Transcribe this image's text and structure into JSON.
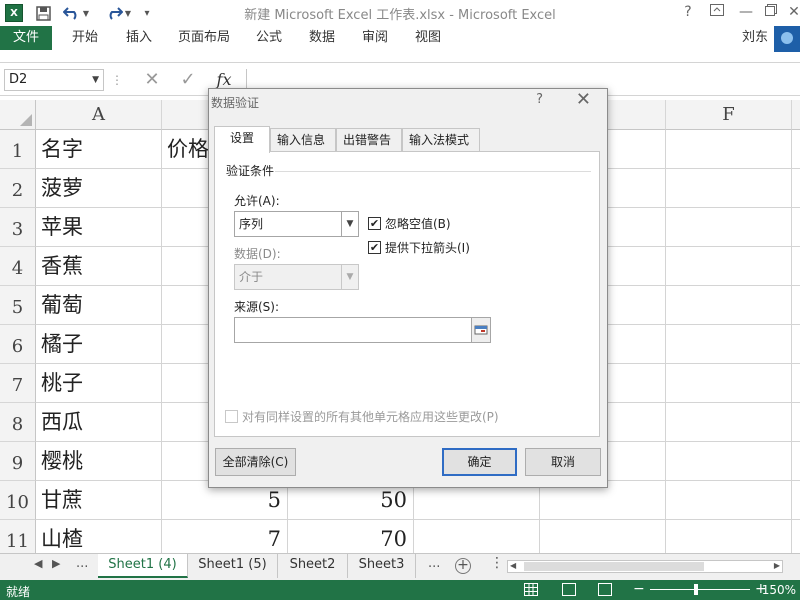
{
  "window": {
    "title": "新建 Microsoft Excel 工作表.xlsx - Microsoft Excel",
    "help": "?",
    "user": "刘东"
  },
  "ribbon": {
    "tabs": [
      "文件",
      "开始",
      "插入",
      "页面布局",
      "公式",
      "数据",
      "审阅",
      "视图"
    ]
  },
  "formula_bar": {
    "name_box": "D2",
    "fx": "fx",
    "content": ""
  },
  "grid": {
    "columns": [
      "A",
      "F"
    ],
    "rows": [
      {
        "n": "1",
        "a": "名字",
        "b": "价格",
        "c": ""
      },
      {
        "n": "2",
        "a": "菠萝",
        "b": "",
        "c": ""
      },
      {
        "n": "3",
        "a": "苹果",
        "b": "",
        "c": ""
      },
      {
        "n": "4",
        "a": "香蕉",
        "b": "",
        "c": ""
      },
      {
        "n": "5",
        "a": "葡萄",
        "b": "",
        "c": ""
      },
      {
        "n": "6",
        "a": "橘子",
        "b": "",
        "c": ""
      },
      {
        "n": "7",
        "a": "桃子",
        "b": "",
        "c": ""
      },
      {
        "n": "8",
        "a": "西瓜",
        "b": "",
        "c": ""
      },
      {
        "n": "9",
        "a": "樱桃",
        "b": "",
        "c": ""
      },
      {
        "n": "10",
        "a": "甘蔗",
        "b": "5",
        "c": "50"
      },
      {
        "n": "11",
        "a": "山楂",
        "b": "7",
        "c": "70"
      }
    ]
  },
  "sheets": {
    "tabs": [
      "Sheet1 (4)",
      "Sheet1 (5)",
      "Sheet2",
      "Sheet3"
    ],
    "active": "Sheet1 (4)",
    "more": "..."
  },
  "status": {
    "text": "就绪",
    "zoom": "150%",
    "zoom_level_percent": 150
  },
  "dialog": {
    "title": "数据验证",
    "help": "?",
    "tabs": [
      "设置",
      "输入信息",
      "出错警告",
      "输入法模式"
    ],
    "active_tab": "设置",
    "section_title": "验证条件",
    "allow_label": "允许(A):",
    "allow_value": "序列",
    "data_label": "数据(D):",
    "data_value": "介于",
    "ignore_blank": {
      "label": "忽略空值(B)",
      "checked": true
    },
    "in_cell_dropdown": {
      "label": "提供下拉箭头(I)",
      "checked": true
    },
    "source_label": "来源(S):",
    "source_value": "",
    "apply_all": {
      "label": "对有同样设置的所有其他单元格应用这些更改(P)",
      "checked": false
    },
    "buttons": {
      "clear_all": "全部清除(C)",
      "ok": "确定",
      "cancel": "取消"
    }
  }
}
